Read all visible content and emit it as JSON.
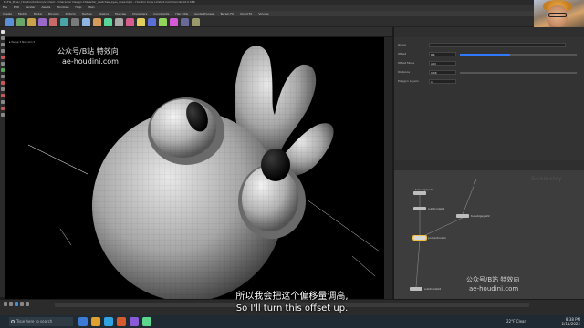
{
  "window": {
    "title": "D:/Hs_Proec_Houdini/Cartoon/v3.hiplc - Character Design Character_sketches_eyes_nose.hiplc - Houdini Indie Limited-Commercial 19.0.586"
  },
  "menu": {
    "items": [
      "File",
      "Edit",
      "Render",
      "Assets",
      "Windows",
      "Help",
      "Main"
    ]
  },
  "shelf": {
    "tabs": [
      "Create",
      "Modify",
      "Model",
      "Polygon",
      "Deform",
      "Texture",
      "Rigging",
      "Muscles",
      "Characters",
      "Constraints",
      "Hair Utils",
      "Guide Process",
      "Terrain FX",
      "Cloud FX",
      "Volume"
    ]
  },
  "viewport": {
    "label": "▸ Persp ▾  No cam ▾"
  },
  "watermark": {
    "line1": "公众号/B站 特效向",
    "line2": "ae-houdini.com"
  },
  "params": {
    "rows": [
      {
        "label": "Group",
        "value": ""
      },
      {
        "label": "Offset",
        "value": "0.1"
      },
      {
        "label": "Offset Mode",
        "value": "Add"
      },
      {
        "label": "Distance",
        "value": "0.06"
      },
      {
        "label": "Polygon Layers",
        "value": "1"
      }
    ]
  },
  "network": {
    "watermark": "Geometry",
    "nodes": [
      {
        "name": "tubebigeye01"
      },
      {
        "name": "subdivide01"
      },
      {
        "name": "tubebigeye02"
      },
      {
        "name": "polyextrude1"
      },
      {
        "name": "subdivide02"
      }
    ],
    "wm_line1": "公众号/B站 特效向",
    "wm_line2": "ae-houdini.com"
  },
  "subtitles": {
    "cn": "所以我会把这个偏移量调高,",
    "en": "So I'll turn this offset up."
  },
  "taskbar": {
    "search_placeholder": "Type here to search",
    "weather": "22°F Clear",
    "time": "8:38 PM",
    "date": "2/11/2022"
  },
  "colors": {
    "accent": "#2f78ff",
    "bg": "#1b1b1b"
  }
}
